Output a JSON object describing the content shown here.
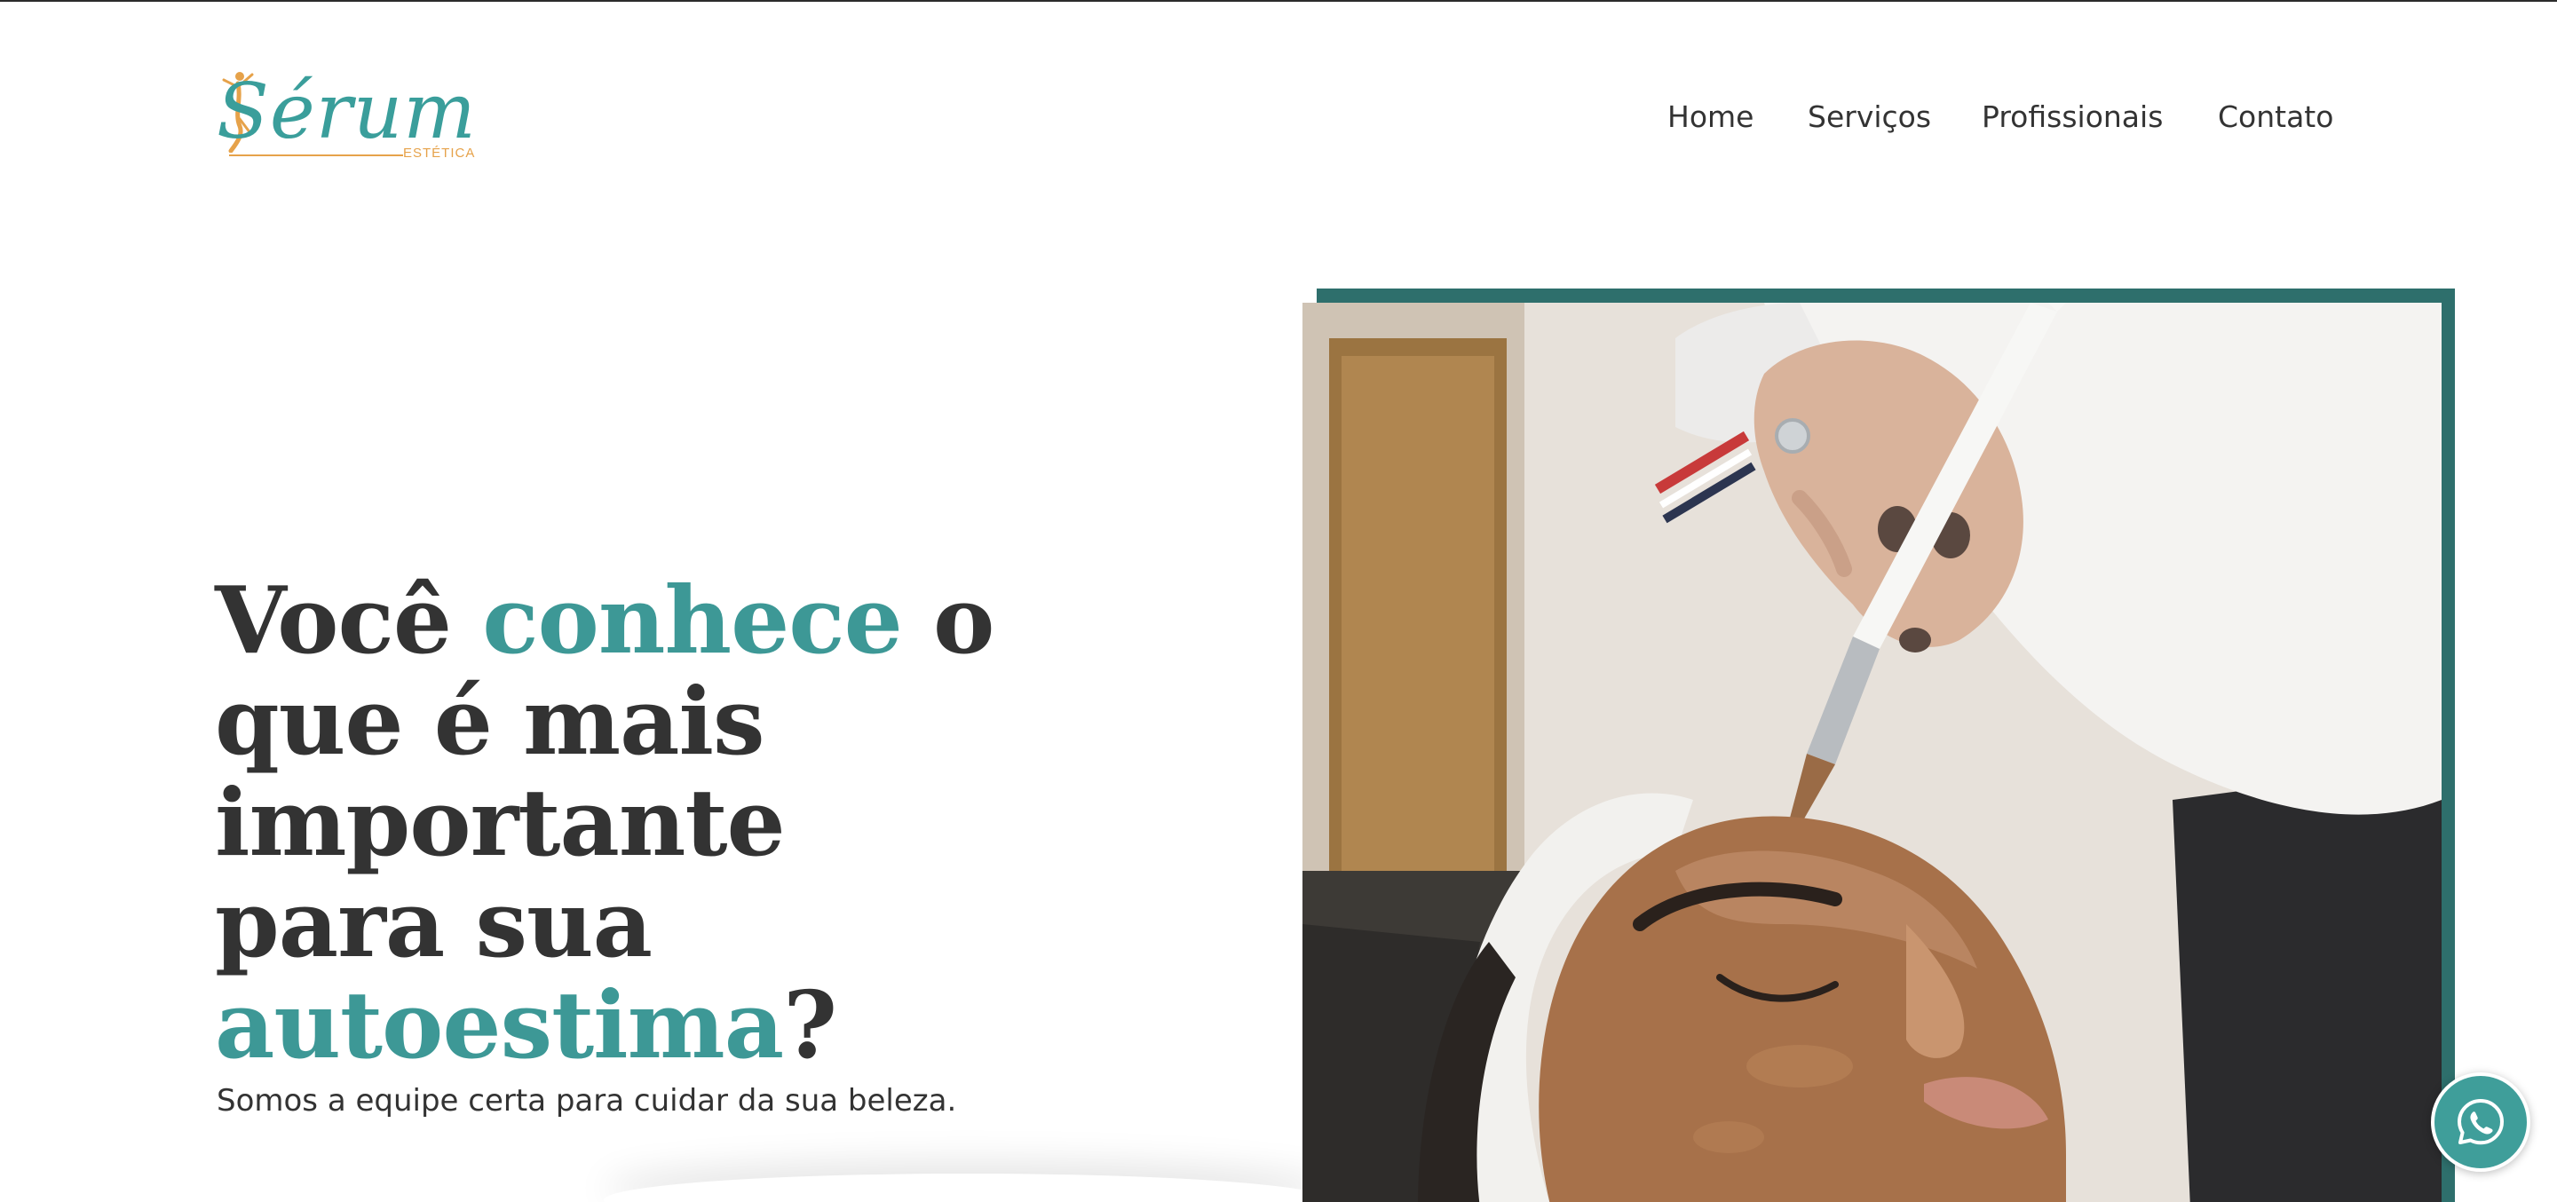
{
  "logo": {
    "word": "Sérum",
    "subtitle": "ESTÉTICA"
  },
  "nav": {
    "items": [
      {
        "label": "Home"
      },
      {
        "label": "Serviços"
      },
      {
        "label": "Profissionais"
      },
      {
        "label": "Contato"
      }
    ]
  },
  "hero": {
    "title_part1": "Você ",
    "title_accent1": "conhece",
    "title_part2": " o que é mais importante para sua ",
    "title_accent2": "autoestima",
    "title_part3": "?",
    "subtitle": "Somos a equipe certa para cuidar da sua beleza."
  },
  "colors": {
    "accent": "#3d9896",
    "frame": "#2e6f6c",
    "text": "#333333",
    "logo_orange": "#e6a24a",
    "whatsapp": "#3f9e9a"
  },
  "icons": {
    "whatsapp": "whatsapp-icon",
    "logo_figure": "dancer-figure-icon"
  }
}
